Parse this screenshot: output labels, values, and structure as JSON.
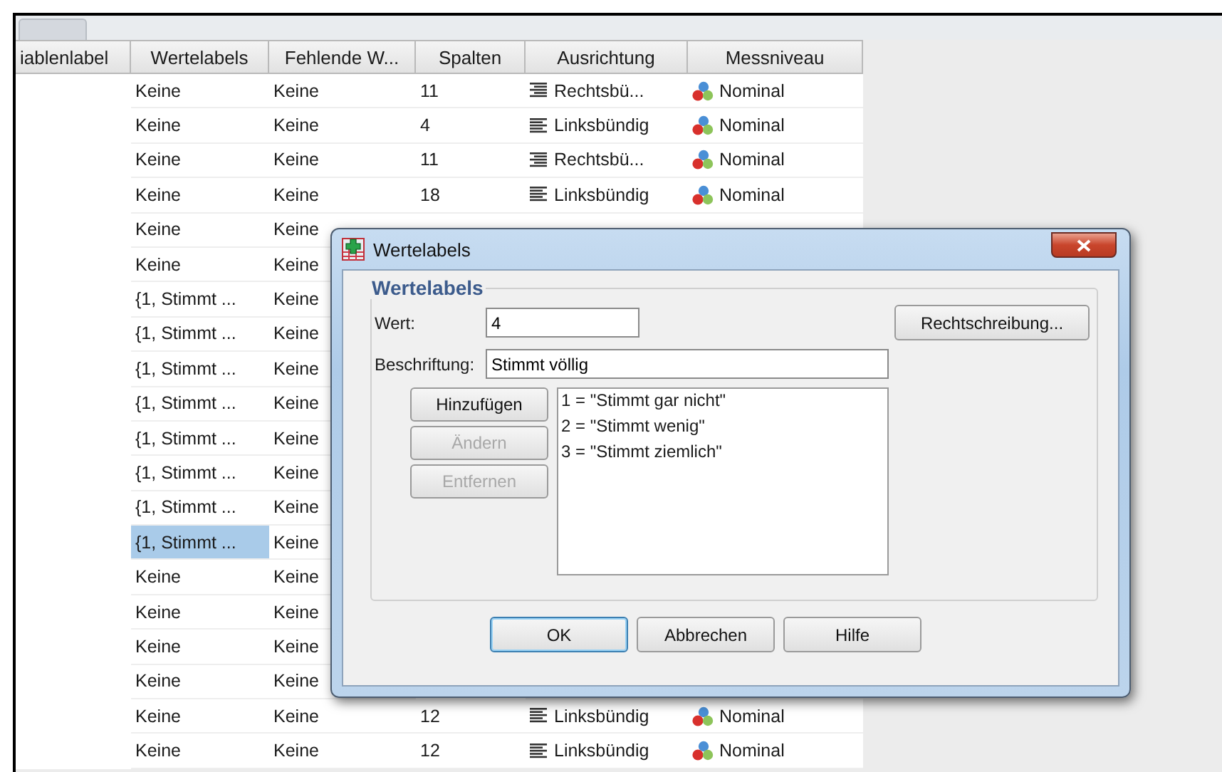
{
  "table": {
    "columns": [
      "iablenlabel",
      "Wertelabels",
      "Fehlende W...",
      "Spalten",
      "Ausrichtung",
      "Messniveau"
    ],
    "rows": [
      {
        "wertelabels": "Keine",
        "fehlende": "Keine",
        "spalten": "11",
        "ausrichtung": {
          "text": "Rechtsbü...",
          "kind": "right"
        },
        "messniveau": "Nominal",
        "selected": false
      },
      {
        "wertelabels": "Keine",
        "fehlende": "Keine",
        "spalten": "4",
        "ausrichtung": {
          "text": "Linksbündig",
          "kind": "left"
        },
        "messniveau": "Nominal",
        "selected": false
      },
      {
        "wertelabels": "Keine",
        "fehlende": "Keine",
        "spalten": "11",
        "ausrichtung": {
          "text": "Rechtsbü...",
          "kind": "right"
        },
        "messniveau": "Nominal",
        "selected": false
      },
      {
        "wertelabels": "Keine",
        "fehlende": "Keine",
        "spalten": "18",
        "ausrichtung": {
          "text": "Linksbündig",
          "kind": "left"
        },
        "messniveau": "Nominal",
        "selected": false
      },
      {
        "wertelabels": "Keine",
        "fehlende": "Keine",
        "selected": false
      },
      {
        "wertelabels": "Keine",
        "fehlende": "Keine",
        "selected": false
      },
      {
        "wertelabels": "{1, Stimmt ...",
        "fehlende": "Keine",
        "selected": false
      },
      {
        "wertelabels": "{1, Stimmt ...",
        "fehlende": "Keine",
        "selected": false
      },
      {
        "wertelabels": "{1, Stimmt ...",
        "fehlende": "Keine",
        "selected": false
      },
      {
        "wertelabels": "{1, Stimmt ...",
        "fehlende": "Keine",
        "selected": false
      },
      {
        "wertelabels": "{1, Stimmt ...",
        "fehlende": "Keine",
        "selected": false
      },
      {
        "wertelabels": "{1, Stimmt ...",
        "fehlende": "Keine",
        "selected": false
      },
      {
        "wertelabels": "{1, Stimmt ...",
        "fehlende": "Keine",
        "selected": false
      },
      {
        "wertelabels": "{1, Stimmt ...",
        "fehlende": "Keine",
        "selected": true
      },
      {
        "wertelabels": "Keine",
        "fehlende": "Keine",
        "selected": false
      },
      {
        "wertelabels": "Keine",
        "fehlende": "Keine",
        "selected": false
      },
      {
        "wertelabels": "Keine",
        "fehlende": "Keine",
        "selected": false
      },
      {
        "wertelabels": "Keine",
        "fehlende": "Keine",
        "selected": false
      },
      {
        "wertelabels": "Keine",
        "fehlende": "Keine",
        "spalten": "12",
        "ausrichtung": {
          "text": "Linksbündig",
          "kind": "left"
        },
        "messniveau": "Nominal",
        "selected": false
      },
      {
        "wertelabels": "Keine",
        "fehlende": "Keine",
        "spalten": "12",
        "ausrichtung": {
          "text": "Linksbündig",
          "kind": "left"
        },
        "messniveau": "Nominal",
        "selected": false
      }
    ]
  },
  "dialog": {
    "title": "Wertelabels",
    "group_title": "Wertelabels",
    "wert": {
      "label": "Wert:",
      "value": "4"
    },
    "beschriftung": {
      "label": "Beschriftung:",
      "value": "Stimmt völlig"
    },
    "spelling_button": "Rechtschreibung...",
    "side_buttons": [
      {
        "label": "Hinzufügen",
        "disabled": false
      },
      {
        "label": "Ändern",
        "disabled": true
      },
      {
        "label": "Entfernen",
        "disabled": true
      }
    ],
    "labels_list": [
      "1 = \"Stimmt gar nicht\"",
      "2 = \"Stimmt wenig\"",
      "3 = \"Stimmt ziemlich\""
    ],
    "buttons": [
      {
        "label": "OK",
        "default": true
      },
      {
        "label": "Abbrechen",
        "default": false
      },
      {
        "label": "Hilfe",
        "default": false
      }
    ]
  }
}
